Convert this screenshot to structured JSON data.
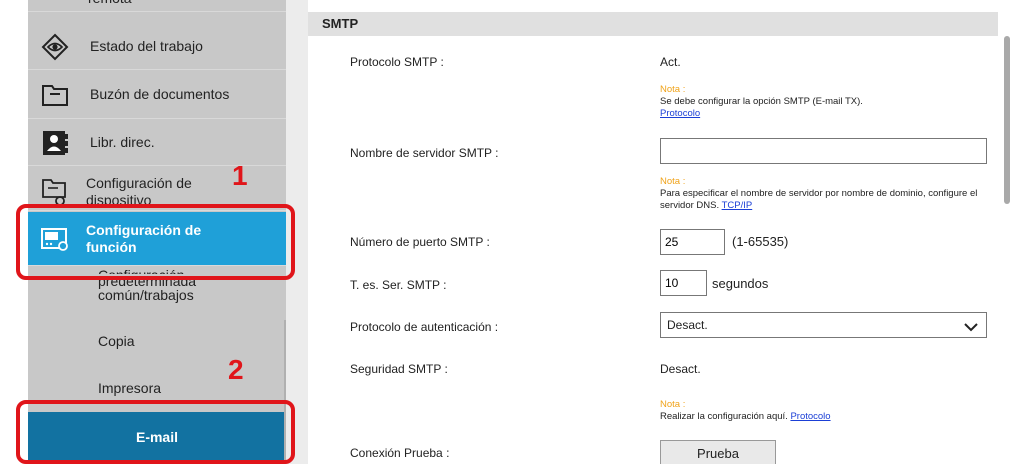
{
  "sidebar": {
    "items": [
      {
        "label": "remota",
        "icon": "cut-off-icon"
      },
      {
        "label": "Estado del trabajo",
        "icon": "eye-icon"
      },
      {
        "label": "Buzón de documentos",
        "icon": "folder-icon"
      },
      {
        "label": "Libr. direc.",
        "icon": "address-book-icon"
      },
      {
        "label": "Configuración de dispositivo",
        "label_line1": "Configuración de",
        "label_line2": "dispositivo",
        "icon": "device-settings-icon"
      },
      {
        "label": "Configuración de función",
        "label_line1": "Configuración de",
        "label_line2": "función",
        "icon": "function-settings-icon",
        "active": true
      }
    ],
    "subitems": [
      {
        "label": "Configuración predeterminada común/trabajos",
        "line1": "Configuración",
        "line2": "predeterminada",
        "line3": "común/trabajos"
      },
      {
        "label": "Copia"
      },
      {
        "label": "Impresora"
      },
      {
        "label": "E-mail",
        "active": true
      }
    ],
    "callouts": [
      "1",
      "2"
    ]
  },
  "section": {
    "title": "SMTP"
  },
  "form": {
    "protocolo_smtp": {
      "label": "Protocolo SMTP :",
      "value": "Act."
    },
    "note1": {
      "title": "Nota :",
      "text": "Se debe configurar la opción SMTP (E-mail TX).",
      "link": "Protocolo"
    },
    "servidor": {
      "label": "Nombre de servidor SMTP :",
      "value": ""
    },
    "note2": {
      "title": "Nota :",
      "text": "Para especificar el nombre de servidor por nombre de dominio, configure el servidor DNS.",
      "link": "TCP/IP"
    },
    "puerto": {
      "label": "Número de puerto SMTP :",
      "value": "25",
      "range": "(1-65535)"
    },
    "timeout": {
      "label": "T. es. Ser. SMTP :",
      "value": "10",
      "unit": "segundos"
    },
    "autenticacion": {
      "label": "Protocolo de autenticación :",
      "selected": "Desact."
    },
    "seguridad": {
      "label": "Seguridad SMTP :",
      "value": "Desact."
    },
    "note3": {
      "title": "Nota :",
      "text": "Realizar la configuración aquí.",
      "link": "Protocolo"
    },
    "prueba": {
      "label": "Conexión Prueba :",
      "button": "Prueba"
    }
  },
  "colors": {
    "active": "#1fa0d8",
    "email": "#1272a1",
    "callout": "#e0151a",
    "note": "#f0a31a",
    "link": "#1b3fd6"
  }
}
